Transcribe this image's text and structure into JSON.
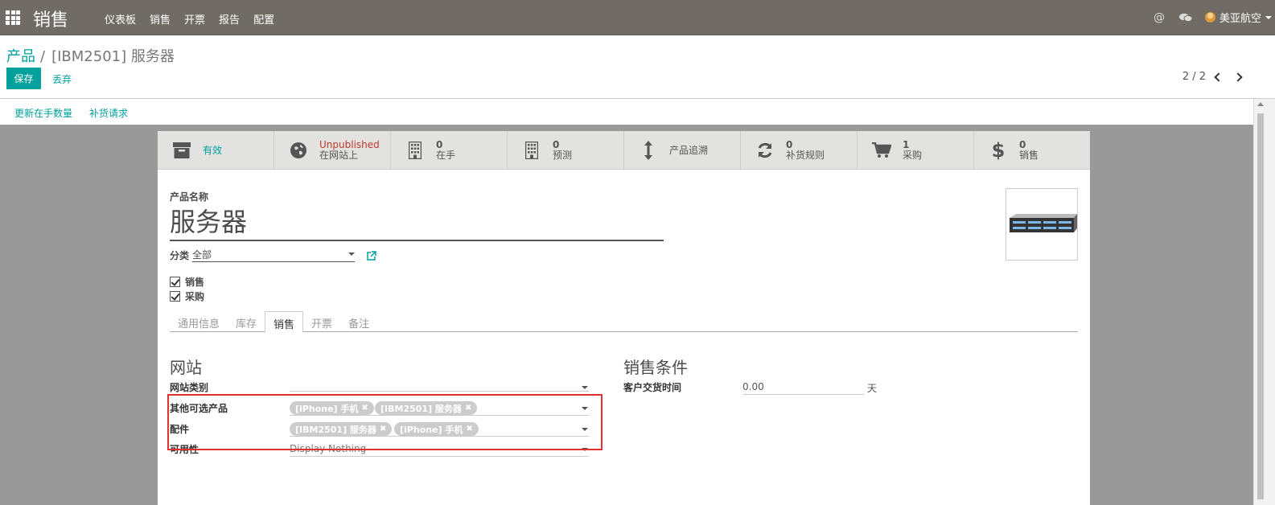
{
  "navbar": {
    "app_title": "销售",
    "menu": [
      "仪表板",
      "销售",
      "开票",
      "报告",
      "配置"
    ],
    "at_icon": "@",
    "user_name": "美亚航空"
  },
  "breadcrumb": {
    "parent": "产品",
    "separator": "/",
    "current": "[IBM2501] 服务器"
  },
  "actions": {
    "save": "保存",
    "discard": "丢弃"
  },
  "pager": {
    "value": "2 / 2"
  },
  "header_buttons": [
    "更新在手数量",
    "补货请求"
  ],
  "smart_buttons": [
    {
      "icon": "archive-icon",
      "value": "有效",
      "label": ""
    },
    {
      "icon": "globe-icon",
      "value": "Unpublished",
      "label": "在网站上"
    },
    {
      "icon": "building-icon",
      "value": "0",
      "label": "在手"
    },
    {
      "icon": "building-icon",
      "value": "0",
      "label": "预测"
    },
    {
      "icon": "arrows-v-icon",
      "value": "产品追溯",
      "label": ""
    },
    {
      "icon": "refresh-icon",
      "value": "0",
      "label": "补货规则"
    },
    {
      "icon": "cart-icon",
      "value": "1",
      "label": "采购"
    },
    {
      "icon": "dollar-icon",
      "value": "0",
      "label": "销售"
    }
  ],
  "form": {
    "name_label": "产品名称",
    "name": "服务器",
    "category_label": "分类",
    "category_value": "全部",
    "sale_ok_label": "销售",
    "purchase_ok_label": "采购",
    "tabs": [
      "通用信息",
      "库存",
      "销售",
      "开票",
      "备注"
    ],
    "active_tab": "销售",
    "website_section": {
      "title": "网站",
      "category_label": "网站类别",
      "alt_products_label": "其他可选产品",
      "alt_products": [
        "[iPhone] 手机",
        "[IBM2501] 服务器"
      ],
      "accessories_label": "配件",
      "accessories": [
        "[IBM2501] 服务器",
        "[iPhone] 手机"
      ],
      "availability_label": "可用性",
      "availability_value": "Display Nothing"
    },
    "sale_conditions": {
      "title": "销售条件",
      "lead_time_label": "客户交货时间",
      "lead_time_value": "0.00",
      "lead_time_unit": "天"
    }
  },
  "colors": {
    "navbar": "#706c65",
    "accent": "#00a09d",
    "highlight_box": "#e03030"
  }
}
